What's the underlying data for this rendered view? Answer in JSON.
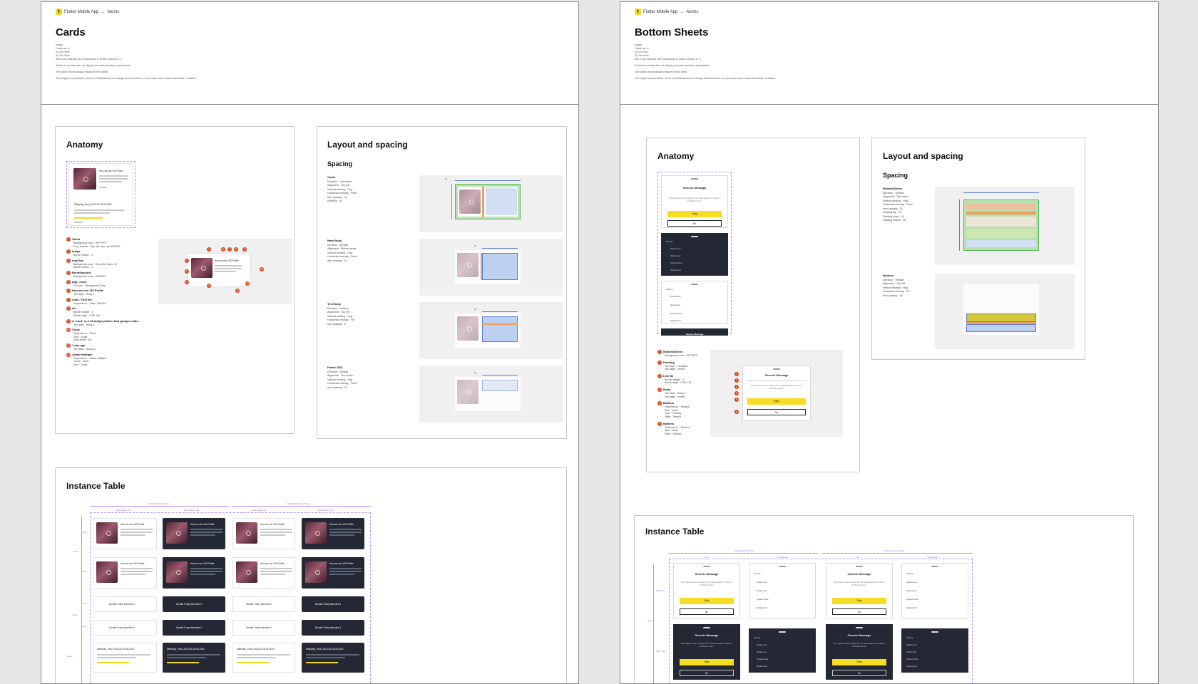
{
  "left_doc": {
    "breadcrumb": {
      "project": "Flutter Mobile App",
      "arrow": "→",
      "section": "Atoms"
    },
    "title": "Cards",
    "desc": [
      "Image",
      "Cards are in",
      "2) Grid View",
      "3) Grid View",
      "with a key Machine (iOS responsive & Small, Android 17+)",
      "If there is no video file, we display an audio waveform placeholder.",
      "The cards should always respect a fixed width.",
      "The height is expandable, users on iOS/Android can change their font sizes, so our cards must remain accessible / scalable."
    ],
    "anatomy": {
      "title": "Anatomy",
      "card_title": "How we use 100 Profile",
      "card_file": "MMeplay_Final_2023-03-18-09-2023",
      "items": [
        {
          "n": "1",
          "name": "Cards",
          "props": [
            "Background color · #FFFFFF",
            "Drop shadow · 1px 1px 2px 1px #000000"
          ]
        },
        {
          "n": "2",
          "name": "Image",
          "props": [
            "Border radius · 4"
          ]
        },
        {
          "n": "3",
          "name": "imgView",
          "props": [
            "Background color · See color token 19",
            "Border radius · 4"
          ]
        },
        {
          "n": "4",
          "name": "Bounding box",
          "props": [
            "Background color · #000000"
          ]
        },
        {
          "n": "5",
          "name": "play_circle",
          "props": [
            "Fill color · Background Grey"
          ]
        },
        {
          "n": "6",
          "name": "How we use 100 Profile",
          "props": [
            "Text style · Body 1"
          ]
        },
        {
          "n": "7",
          "name": "Lists / Titel file",
          "props": [
            "Depends on · Lists / Titel file"
          ]
        },
        {
          "n": "8",
          "name": "div",
          "props": [
            "Border weight · 1",
            "Border style · LINE 116"
          ]
        },
        {
          "n": "9",
          "name": "A \"card\" is a UI design pattern that groups relate...",
          "props": [
            "Text style · Body 2"
          ]
        },
        {
          "n": "10",
          "name": "Clock",
          "props": [
            "Depends on · Clock",
            "Size · Small",
            "Dark Mode · No"
          ]
        },
        {
          "n": "11",
          "name": "1 day ago",
          "props": [
            "Text style · Body xs"
          ]
        },
        {
          "n": "12",
          "name": "Avatar Multiple",
          "props": [
            "Depends on · Avatar Multiple",
            "Count · None",
            "Size · Small"
          ]
        }
      ]
    },
    "layout": {
      "title": "Layout and spacing",
      "subtitle": "Spacing",
      "blocks": [
        {
          "name": "Cards",
          "props": [
            "Direction · Horizontal",
            "Alignment · Top left",
            "Vertical resizing · Hug",
            "Horizontal resizing · Fixed",
            "Item spacing · 16",
            "Padding · 16"
          ],
          "dim": "16"
        },
        {
          "name": "Main Body",
          "props": [
            "Direction · Vertical",
            "Alignment · Middle center",
            "Vertical resizing · Hug",
            "Horizontal resizing · Fixed",
            "Item spacing · 16"
          ],
          "dim": "16"
        },
        {
          "name": "Text Body",
          "props": [
            "Direction · Vertical",
            "Alignment · Top left",
            "Vertical resizing · Hug",
            "Horizontal resizing · Fill",
            "Item spacing · 8"
          ],
          "dim": "16"
        },
        {
          "name": "Frame 2811",
          "props": [
            "Direction · Vertical",
            "Alignment · Top center",
            "Vertical resizing · Hug",
            "Horizontal resizing · Fixed",
            "Item spacing · 16"
          ],
          "dim": "16"
        }
      ]
    },
    "instance": {
      "title": "Instance Table",
      "top_labels": [
        "Show File Name: True",
        "Show File Name: False"
      ],
      "col_labels": [
        "Dark Mode: No",
        "Dark Mode: Yes",
        "Dark Mode: No",
        "Dark Mode: Yes"
      ],
      "row_labels": [
        "Hub",
        "Card",
        "Grid",
        "Grid",
        "Data",
        "Hub",
        "Data"
      ],
      "short_title": "Donald Trump interview 2"
    }
  },
  "right_doc": {
    "breadcrumb": {
      "project": "Flutter Mobile App",
      "arrow": "→",
      "section": "Atoms"
    },
    "title": "Bottom Sheets",
    "desc": [
      "Image",
      "Cards are in",
      "2) List View",
      "3) Grid View",
      "with a key Machine (iOS responsive & Small, Android 17+)",
      "If there is no video file, we display an audio waveform placeholder.",
      "The cards should always respect a fixed width.",
      "The height is expandable, users on iOS/Android can change their font sizes, so our cards must remain accessible / scalable."
    ],
    "anatomy": {
      "title": "Anatomy",
      "generic": "Generic Message",
      "message": "The engineers may be happy that I've finally added an X button to the Bottom Sheet.",
      "okay": "Okay",
      "no": "No",
      "sort_by": "Sort by",
      "options": [
        "Option one",
        "Option two",
        "Option three",
        "Option four"
      ],
      "items": [
        {
          "n": "1",
          "name": "BottomSheets",
          "props": [
            "Background color · #FFFFFF"
          ]
        },
        {
          "n": "2",
          "name": "Heading",
          "props": [
            "Text style · Headline",
            "Text align · center"
          ]
        },
        {
          "n": "3",
          "name": "Line 88",
          "props": [
            "Border weight · 1",
            "Border style · LINE 116"
          ]
        },
        {
          "n": "4",
          "name": "Body",
          "props": [
            "Text style · Body 2",
            "Text align · center"
          ]
        },
        {
          "n": "5",
          "name": "Buttons",
          "props": [
            "Depends on · Buttons",
            "Size · None",
            "Type · Primary",
            "State · Default"
          ]
        },
        {
          "n": "6",
          "name": "Buttons",
          "props": [
            "Depends on · Buttons",
            "Size · None",
            "State · Default"
          ]
        }
      ]
    },
    "layout": {
      "title": "Layout and spacing",
      "subtitle": "Spacing",
      "blocks": [
        {
          "name": "BottomSheets",
          "props": [
            "Direction · Vertical",
            "Alignment · Top center",
            "Vertical resizing · Hug",
            "Horizontal resizing · Fixed",
            "Item spacing · 24",
            "Padding top · 24",
            "Padding sides · 16",
            "Padding bottom · 36"
          ]
        },
        {
          "name": "Buttons",
          "props": [
            "Direction · Vertical",
            "Alignment · Top left",
            "Vertical resizing · Hug",
            "Horizontal resizing · Fill",
            "Item spacing · 16"
          ]
        }
      ]
    },
    "instance": {
      "title": "Instance Table",
      "top_labels": [
        "Show Left Icon: True",
        "Show Left Icon: False"
      ],
      "col_labels": [
        "CTA",
        "Contextual",
        "CTA",
        "Contextual"
      ],
      "row_labels": [
        "Dark: No",
        "Dark: Yes",
        "Sort"
      ]
    }
  },
  "colors": {
    "accent_yellow": "#F6DC22",
    "anno_orange": "#D74A1C",
    "annotation_purple": "#9A5DE0",
    "dark_card": "#232834"
  }
}
